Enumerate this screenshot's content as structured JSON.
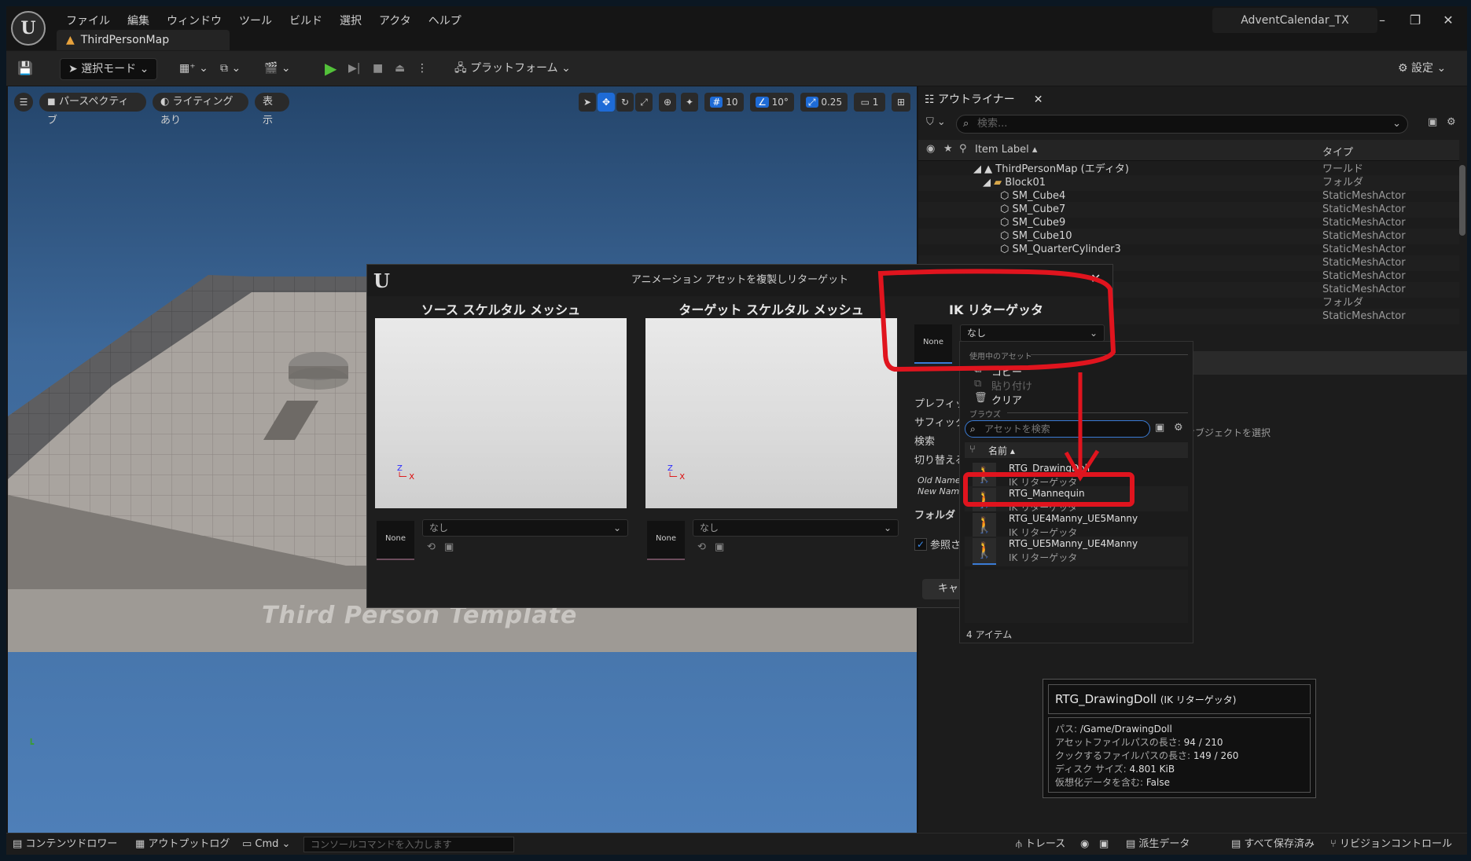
{
  "app": {
    "menu": [
      "ファイル",
      "編集",
      "ウィンドウ",
      "ツール",
      "ビルド",
      "選択",
      "アクタ",
      "ヘルプ"
    ],
    "map_tab": "ThirdPersonMap",
    "project_name": "AdventCalendar_TX"
  },
  "toolbar": {
    "select_mode": "選択モード",
    "platform": "プラットフォーム",
    "settings": "設定"
  },
  "viewport": {
    "perspective": "パースペクティブ",
    "lighting": "ライティングあり",
    "show": "表示",
    "grid_value": "10",
    "angle_value": "10°",
    "scale_value": "0.25",
    "camera_value": "1",
    "floor_text": "Third Person Template"
  },
  "outliner": {
    "tab": "アウトライナー",
    "search_placeholder": "検索...",
    "col_label": "Item Label",
    "col_type": "タイプ",
    "rows": [
      {
        "label": "ThirdPersonMap (エディタ)",
        "type": "ワールド"
      },
      {
        "label": "Block01",
        "type": "フォルダ"
      },
      {
        "label": "SM_Cube4",
        "type": "StaticMeshActor"
      },
      {
        "label": "SM_Cube7",
        "type": "StaticMeshActor"
      },
      {
        "label": "SM_Cube9",
        "type": "StaticMeshActor"
      },
      {
        "label": "SM_Cube10",
        "type": "StaticMeshActor"
      },
      {
        "label": "SM_QuarterCylinder3",
        "type": "StaticMeshActor"
      },
      {
        "label": "",
        "type": "StaticMeshActor"
      },
      {
        "label": "",
        "type": "StaticMeshActor"
      },
      {
        "label": "",
        "type": "StaticMeshActor"
      },
      {
        "label": "",
        "type": "フォルダ"
      },
      {
        "label": "",
        "type": "StaticMeshActor"
      }
    ],
    "select_object_hint": "オブジェクトを選択"
  },
  "dialog": {
    "title": "アニメーション アセットを複製しリターゲット",
    "source_title": "ソース スケルタル メッシュ",
    "target_title": "ターゲット スケルタル メッシュ",
    "ik_title": "IK リターゲッタ",
    "thumb_none": "None",
    "combo_none": "なし",
    "labels": {
      "prefix": "プレフィック",
      "suffix": "サフィックス",
      "search": "検索",
      "replace": "切り替える",
      "old_name": "Old Name",
      "new_name": "New Name",
      "folder": "フォルダ",
      "reference": "参照さ",
      "cancel": "キャ"
    }
  },
  "dropdown": {
    "section_current": "使用中のアセット",
    "copy": "コピー",
    "paste": "貼り付け",
    "clear": "クリア",
    "section_browse": "ブラウズ",
    "search_placeholder": "アセットを検索",
    "col_name": "名前",
    "assets": [
      {
        "name": "RTG_DrawingDoll",
        "type": "IK リターゲッタ"
      },
      {
        "name": "RTG_Mannequin",
        "type": "IK リターゲッタ"
      },
      {
        "name": "RTG_UE4Manny_UE5Manny",
        "type": "IK リターゲッタ"
      },
      {
        "name": "RTG_UE5Manny_UE4Manny",
        "type": "IK リターゲッタ"
      }
    ],
    "item_count": "4 アイテム"
  },
  "tooltip": {
    "title": "RTG_DrawingDoll",
    "title_type": "(IK リターゲッタ)",
    "path_label": "パス:",
    "path_value": "/Game/DrawingDoll",
    "asset_path_len_label": "アセットファイルパスの長さ:",
    "asset_path_len_value": "94 / 210",
    "cook_path_len_label": "クックするファイルパスの長さ:",
    "cook_path_len_value": "149 / 260",
    "disk_size_label": "ディスク サイズ:",
    "disk_size_value": "4.801 KiB",
    "virtualized_label": "仮想化データを含む:",
    "virtualized_value": "False"
  },
  "statusbar": {
    "content_drawer": "コンテンツドロワー",
    "output_log": "アウトプットログ",
    "cmd": "Cmd",
    "console_placeholder": "コンソールコマンドを入力します",
    "trace": "トレース",
    "derived_data": "派生データ",
    "all_saved": "すべて保存済み",
    "revision_control": "リビジョンコントロール"
  },
  "colors": {
    "accent_blue": "#1e6bd6",
    "annotation_red": "#e0141e",
    "play_green": "#53c13a"
  }
}
